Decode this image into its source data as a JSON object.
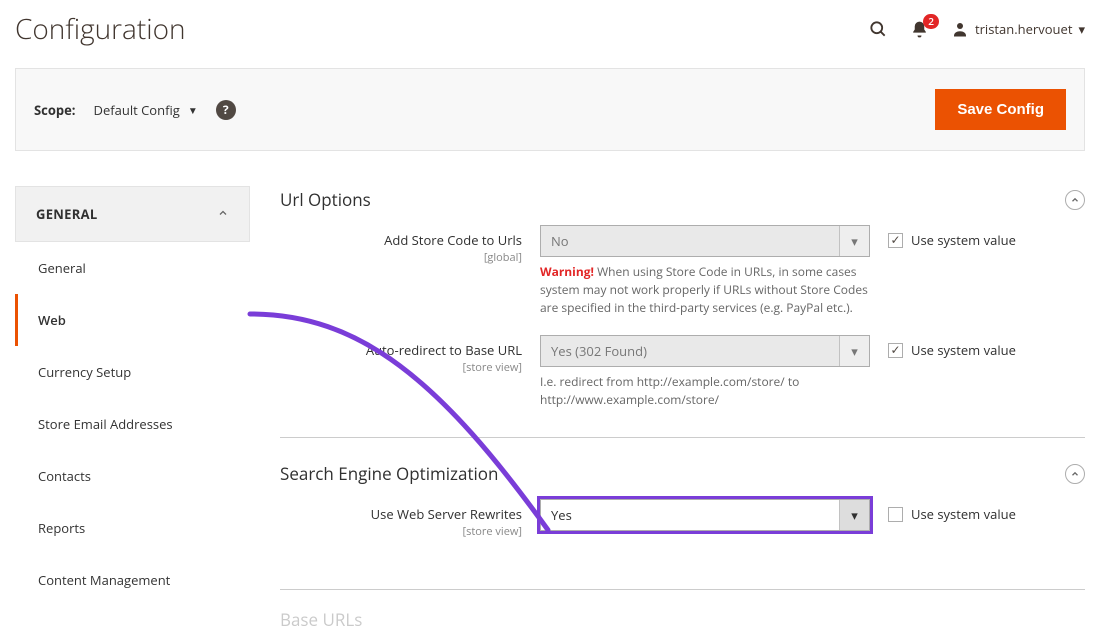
{
  "header": {
    "title": "Configuration",
    "notification_count": "2",
    "username": "tristan.hervouet"
  },
  "scope_bar": {
    "label": "Scope:",
    "selected": "Default Config",
    "save_button": "Save Config"
  },
  "sidebar": {
    "group_label": "GENERAL",
    "items": [
      {
        "label": "General"
      },
      {
        "label": "Web",
        "active": true
      },
      {
        "label": "Currency Setup"
      },
      {
        "label": "Store Email Addresses"
      },
      {
        "label": "Contacts"
      },
      {
        "label": "Reports"
      },
      {
        "label": "Content Management"
      }
    ]
  },
  "sections": {
    "url_options": {
      "title": "Url Options",
      "fields": {
        "store_code": {
          "label": "Add Store Code to Urls",
          "scope": "[global]",
          "value": "No",
          "note_prefix": "Warning!",
          "note_body": " When using Store Code in URLs, in some cases system may not work properly if URLs without Store Codes are specified in the third-party services (e.g. PayPal etc.).",
          "use_system_label": "Use system value",
          "use_system_checked": true
        },
        "auto_redirect": {
          "label": "Auto-redirect to Base URL",
          "scope": "[store view]",
          "value": "Yes (302 Found)",
          "note": "I.e. redirect from http://example.com/store/ to http://www.example.com/store/",
          "use_system_label": "Use system value",
          "use_system_checked": true
        }
      }
    },
    "seo": {
      "title": "Search Engine Optimization",
      "fields": {
        "rewrites": {
          "label": "Use Web Server Rewrites",
          "scope": "[store view]",
          "value": "Yes",
          "use_system_label": "Use system value",
          "use_system_checked": false
        }
      }
    },
    "base_urls": {
      "title": "Base URLs"
    }
  }
}
